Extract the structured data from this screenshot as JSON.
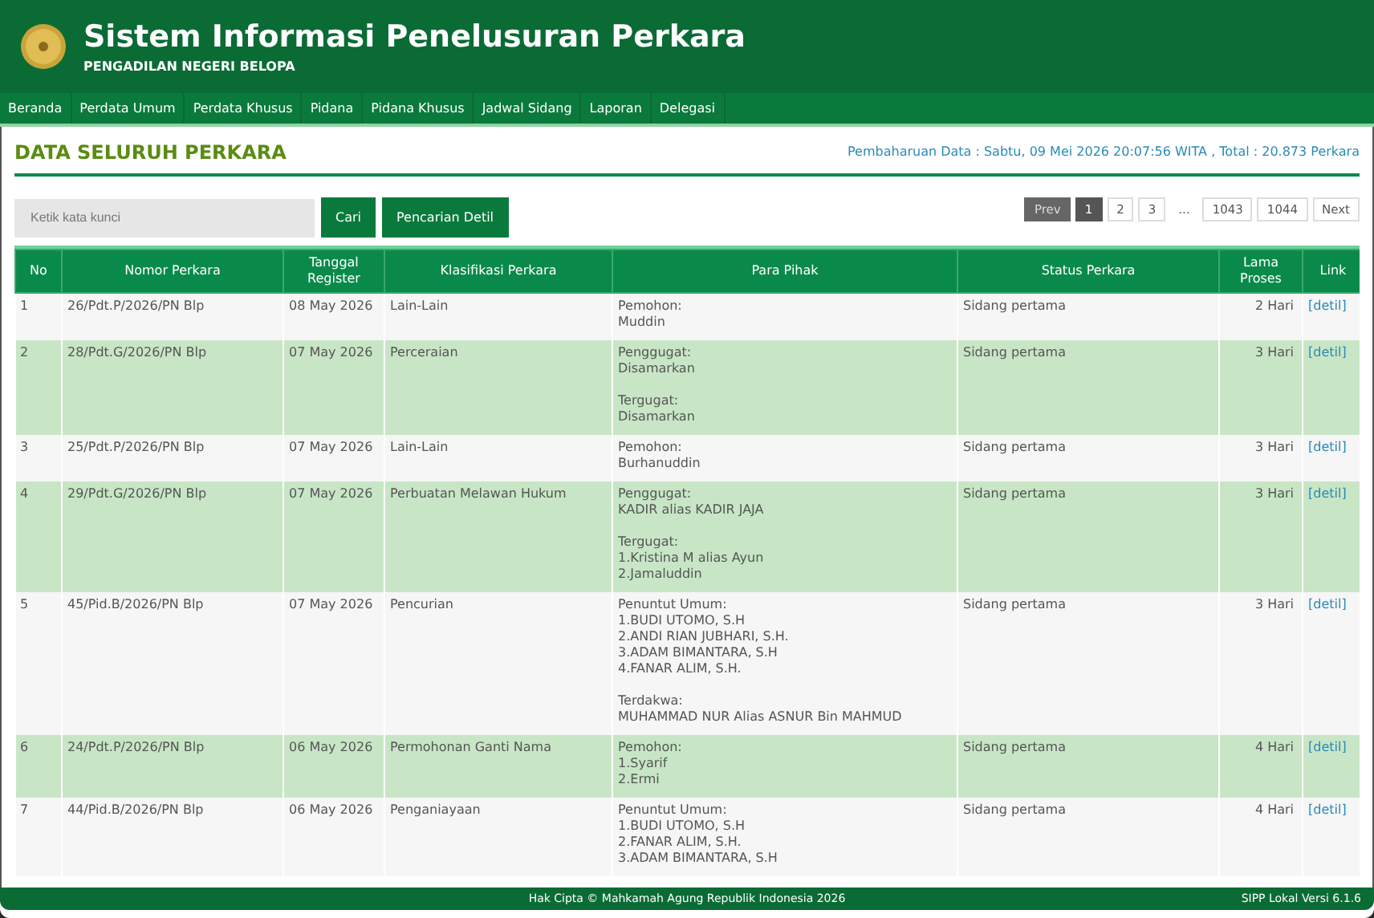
{
  "header": {
    "title": "Sistem Informasi Penelusuran Perkara",
    "subtitle": "PENGADILAN NEGERI BELOPA"
  },
  "nav": [
    "Beranda",
    "Perdata Umum",
    "Perdata Khusus",
    "Pidana",
    "Pidana Khusus",
    "Jadwal Sidang",
    "Laporan",
    "Delegasi"
  ],
  "page_title": "DATA SELURUH PERKARA",
  "update_info": "Pembaharuan Data : Sabtu, 09 Mei 2026 20:07:56 WITA , Total : 20.873 Perkara",
  "search": {
    "placeholder": "Ketik kata kunci",
    "button": "Cari",
    "detail_button": "Pencarian Detil"
  },
  "pagination": [
    {
      "label": "Prev",
      "kind": "nav",
      "disabled": true
    },
    {
      "label": "1",
      "kind": "page",
      "selected": true
    },
    {
      "label": "2",
      "kind": "page",
      "selected": false
    },
    {
      "label": "3",
      "kind": "page",
      "selected": false
    },
    {
      "label": "...",
      "kind": "gap"
    },
    {
      "label": "1043",
      "kind": "page",
      "selected": false
    },
    {
      "label": "1044",
      "kind": "page",
      "selected": false
    },
    {
      "label": "Next",
      "kind": "nav",
      "disabled": false
    }
  ],
  "table": {
    "columns": [
      "No",
      "Nomor Perkara",
      "Tanggal Register",
      "Klasifikasi Perkara",
      "Para Pihak",
      "Status Perkara",
      "Lama Proses",
      "Link"
    ],
    "rows": [
      {
        "no": "1",
        "nomor": "26/Pdt.P/2026/PN Blp",
        "tanggal": "08 May 2026",
        "klasifikasi": "Lain-Lain",
        "pihak": [
          {
            "role": "Pemohon:",
            "names": [
              "Muddin"
            ]
          }
        ],
        "status": "Sidang pertama",
        "lama": "2 Hari",
        "link": "[detil]"
      },
      {
        "no": "2",
        "nomor": "28/Pdt.G/2026/PN Blp",
        "tanggal": "07 May 2026",
        "klasifikasi": "Perceraian",
        "pihak": [
          {
            "role": "Penggugat:",
            "names": [
              "Disamarkan"
            ]
          },
          {
            "role": "Tergugat:",
            "names": [
              "Disamarkan"
            ]
          }
        ],
        "status": "Sidang pertama",
        "lama": "3 Hari",
        "link": "[detil]"
      },
      {
        "no": "3",
        "nomor": "25/Pdt.P/2026/PN Blp",
        "tanggal": "07 May 2026",
        "klasifikasi": "Lain-Lain",
        "pihak": [
          {
            "role": "Pemohon:",
            "names": [
              "Burhanuddin"
            ]
          }
        ],
        "status": "Sidang pertama",
        "lama": "3 Hari",
        "link": "[detil]"
      },
      {
        "no": "4",
        "nomor": "29/Pdt.G/2026/PN Blp",
        "tanggal": "07 May 2026",
        "klasifikasi": "Perbuatan Melawan Hukum",
        "pihak": [
          {
            "role": "Penggugat:",
            "names": [
              "KADIR alias KADIR JAJA"
            ]
          },
          {
            "role": "Tergugat:",
            "names": [
              "1.Kristina M alias Ayun",
              "2.Jamaluddin"
            ]
          }
        ],
        "status": "Sidang pertama",
        "lama": "3 Hari",
        "link": "[detil]"
      },
      {
        "no": "5",
        "nomor": "45/Pid.B/2026/PN Blp",
        "tanggal": "07 May 2026",
        "klasifikasi": "Pencurian",
        "pihak": [
          {
            "role": "Penuntut Umum:",
            "names": [
              "1.BUDI UTOMO, S.H",
              "2.ANDI RIAN JUBHARI, S.H.",
              "3.ADAM BIMANTARA, S.H",
              "4.FANAR ALIM, S.H."
            ]
          },
          {
            "role": "Terdakwa:",
            "names": [
              "MUHAMMAD NUR Alias ASNUR Bin MAHMUD"
            ]
          }
        ],
        "status": "Sidang pertama",
        "lama": "3 Hari",
        "link": "[detil]"
      },
      {
        "no": "6",
        "nomor": "24/Pdt.P/2026/PN Blp",
        "tanggal": "06 May 2026",
        "klasifikasi": "Permohonan Ganti Nama",
        "pihak": [
          {
            "role": "Pemohon:",
            "names": [
              "1.Syarif",
              "2.Ermi"
            ]
          }
        ],
        "status": "Sidang pertama",
        "lama": "4 Hari",
        "link": "[detil]"
      },
      {
        "no": "7",
        "nomor": "44/Pid.B/2026/PN Blp",
        "tanggal": "06 May 2026",
        "klasifikasi": "Penganiayaan",
        "pihak": [
          {
            "role": "Penuntut Umum:",
            "names": [
              "1.BUDI UTOMO, S.H",
              "2.FANAR ALIM, S.H.",
              "3.ADAM BIMANTARA, S.H"
            ]
          }
        ],
        "status": "Sidang pertama",
        "lama": "4 Hari",
        "link": "[detil]"
      }
    ]
  },
  "footer": {
    "copyright": "Hak Cipta © Mahkamah Agung Republik Indonesia 2026",
    "version": "SIPP Lokal Versi 6.1.6"
  }
}
